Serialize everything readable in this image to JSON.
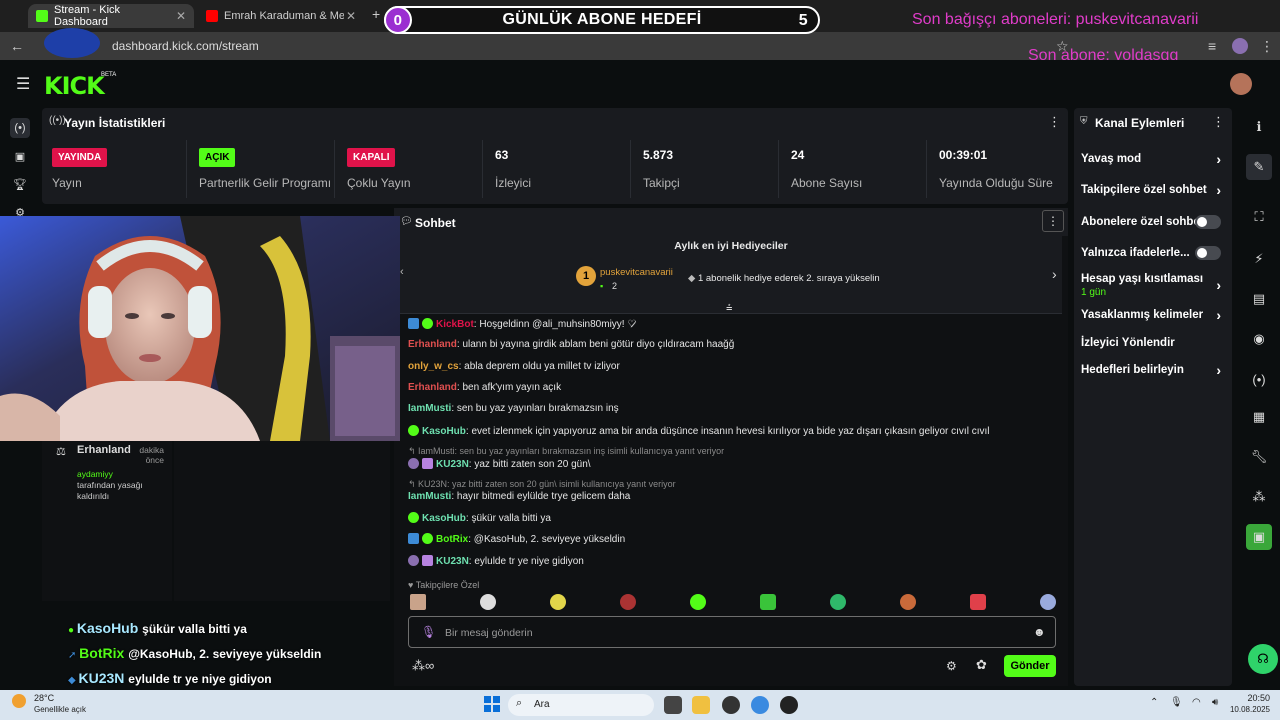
{
  "browser": {
    "tabs": [
      {
        "title": "Stream - Kick Dashboard",
        "active": true
      },
      {
        "title": "Emrah Karaduman & Merve Ö",
        "active": false
      }
    ],
    "new_tab": "+",
    "url": "dashboard.kick.com/stream"
  },
  "overlay": {
    "goal_title": "GÜNLÜK ABONE HEDEFİ",
    "goal_current": "0",
    "goal_target": "5",
    "last_gift": "Son bağışçı aboneleri: puskevitcanavarii",
    "last_sub": "Son abone: yoldasgg"
  },
  "header": {
    "logo": "KICK",
    "beta": "BETA"
  },
  "stats": {
    "title": "Yayın İstatistikleri",
    "items": [
      {
        "badge": "YAYINDA",
        "label": "Yayın"
      },
      {
        "badge": "AÇIK",
        "label": "Partnerlik Gelir Programı"
      },
      {
        "badge": "KAPALI",
        "label": "Çoklu Yayın"
      },
      {
        "value": "63",
        "label": "İzleyici"
      },
      {
        "value": "5.873",
        "label": "Takipçi"
      },
      {
        "value": "24",
        "label": "Abone Sayısı"
      },
      {
        "value": "00:39:01",
        "label": "Yayında Olduğu Süre"
      }
    ]
  },
  "actions": {
    "title": "Kanal Eylemleri",
    "items": [
      {
        "label": "Yavaş mod"
      },
      {
        "label": "Takipçilere özel sohbet"
      },
      {
        "label": "Abonelere özel sohbet"
      },
      {
        "label": "Yalnızca ifadelerle..."
      },
      {
        "label": "Hesap yaşı kısıtlaması",
        "sub": "1 gün"
      },
      {
        "label": "Yasaklanmış kelimeler"
      },
      {
        "label": "İzleyici Yönlendir"
      },
      {
        "label": "Hedefleri belirleyin"
      }
    ]
  },
  "chat": {
    "title": "Sohbet",
    "gifters_title": "Aylık en iyi Hediyeciler",
    "top_gifter": {
      "rank": "1",
      "name": "puskevitcanavarii",
      "count": "2"
    },
    "gift_hint": "1 abonelik hediye ederek 2. sıraya yükselin",
    "messages": [
      {
        "user": "KickBot",
        "text": ": Hoşgeldinn @ali_muhsin80miyy! ♡̷"
      },
      {
        "user": "Erhanland",
        "text": ": ulann bi yayına girdik ablam beni götür diyo çıldıracam haağğ"
      },
      {
        "user": "only_w_cs",
        "text": ": abla deprem oldu ya millet tv izliyor"
      },
      {
        "user": "Erhanland",
        "text": ": ben afk'yım yayın açık"
      },
      {
        "user": "IamMusti",
        "text": ": sen bu yaz yayınları bırakmazsın inş"
      },
      {
        "user": "KasoHub",
        "text": ": evet izlenmek için yapıyoruz ama bir anda düşünce insanın hevesi kırılıyor ya bide yaz dışarı çıkasın geliyor cıvıl cıvıl"
      },
      {
        "reply": "IamMusti: sen bu yaz yayınları bırakmazsın inş isimli kullanıcıya yanıt veriyor"
      },
      {
        "user": "KU23N",
        "text": ": yaz bitti zaten son 20 gün\\"
      },
      {
        "reply": "KU23N: yaz bitti zaten son 20 gün\\ isimli kullanıcıya yanıt veriyor"
      },
      {
        "user": "IamMusti",
        "text": ": hayır bitmedi eylülde trye gelicem daha"
      },
      {
        "user": "KasoHub",
        "text": ": şükür valla bitti ya"
      },
      {
        "user": "BotRix",
        "text": ": @KasoHub, 2. seviyeye yükseldin"
      },
      {
        "user": "KU23N",
        "text": ": eylulde tr ye niye gidiyon"
      }
    ],
    "emote_section": "Takipçilere Özel",
    "input_placeholder": "Bir mesaj gönderin",
    "send_label": "Gönder"
  },
  "left_panel": {
    "user": "Erhanland",
    "time": "dakika önce",
    "mod_user": "aydamiyy",
    "mod_text": "tarafından yasağı kaldırıldı"
  },
  "overlay_chat": [
    {
      "user": "KasoHub",
      "text": "şükür valla bitti ya"
    },
    {
      "user": "BotRix",
      "text": "@KasoHub, 2. seviyeye yükseldin"
    },
    {
      "user": "KU23N",
      "text": "eylulde tr ye niye gidiyon"
    }
  ],
  "taskbar": {
    "weather_temp": "28°C",
    "weather_desc": "Genellikle açık",
    "search": "Ara",
    "time": "20:50",
    "date": "10.08.2025"
  },
  "colors": {
    "kick_green": "#53fc18",
    "overlay_pink": "#e03cc9",
    "goal_purple": "#9b2fd1"
  }
}
